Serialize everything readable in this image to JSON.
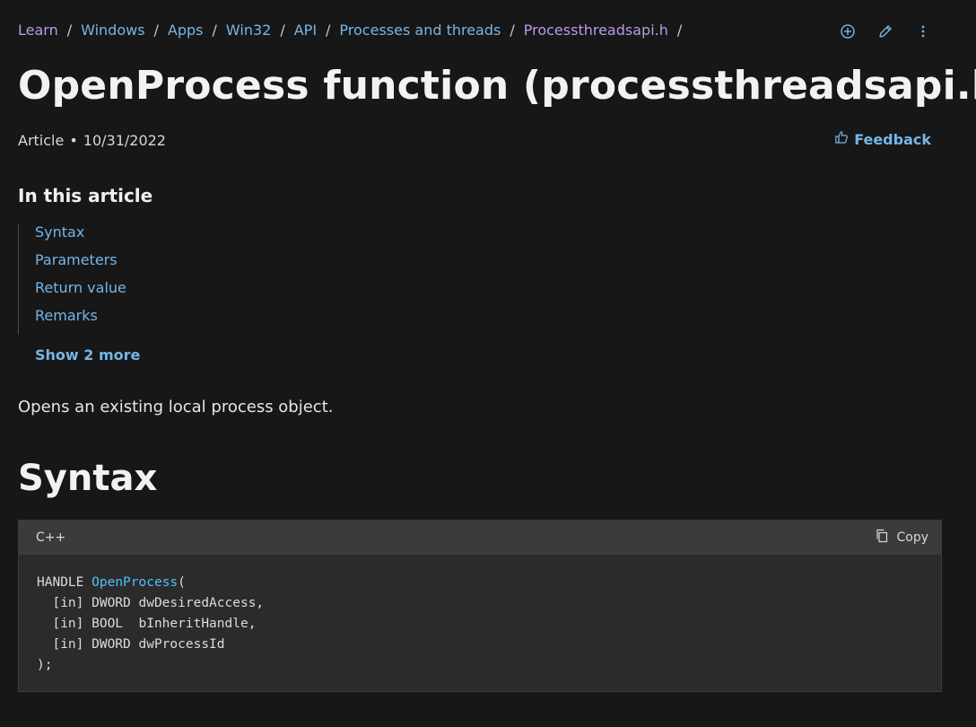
{
  "breadcrumb": {
    "items": [
      "Learn",
      "Windows",
      "Apps",
      "Win32",
      "API",
      "Processes and threads",
      "Processthreadsapi.h"
    ],
    "separator": "/"
  },
  "top_actions": [
    "add-collection-icon",
    "edit-icon",
    "more-options-icon"
  ],
  "title": "OpenProcess function (processthreadsapi.h)",
  "meta": {
    "type": "Article",
    "dot": "•",
    "date": "10/31/2022"
  },
  "feedback_label": "Feedback",
  "toc": {
    "title": "In this article",
    "items": [
      "Syntax",
      "Parameters",
      "Return value",
      "Remarks"
    ],
    "show_more": "Show 2 more"
  },
  "summary": "Opens an existing local process object.",
  "section_title": "Syntax",
  "code": {
    "language": "C++",
    "copy_label": "Copy",
    "return_type": "HANDLE",
    "function_name": "OpenProcess",
    "open_paren": "(",
    "lines": [
      "  [in] DWORD dwDesiredAccess,",
      "  [in] BOOL  bInheritHandle,",
      "  [in] DWORD dwProcessId"
    ],
    "closing": ");"
  },
  "colors": {
    "background": "#171717",
    "link": "#75b6e7",
    "visited_link": "#b99ae6",
    "code_function": "#4fc1ff"
  }
}
